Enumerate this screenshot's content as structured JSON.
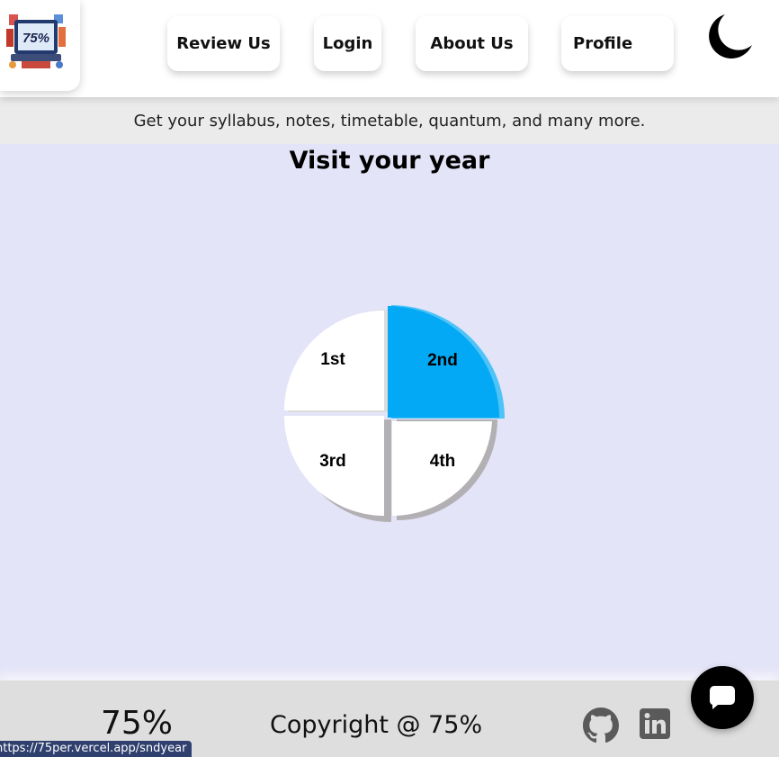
{
  "header": {
    "logo_text": "75%",
    "nav": {
      "review": "Review Us",
      "login": "Login",
      "about": "About Us",
      "profile": "Profile"
    },
    "theme_icon": "moon-icon"
  },
  "tagline": "Get your syllabus, notes, timetable, quantum, and many more.",
  "main": {
    "title": "Visit your year",
    "years": [
      "1st",
      "2nd",
      "3rd",
      "4th"
    ],
    "highlight_color": "#03a9f4",
    "active_year": "2nd"
  },
  "footer": {
    "brand": "75%",
    "copyright": "Copyright @ 75%",
    "icons": [
      "github-icon",
      "linkedin-icon"
    ]
  },
  "chat": {
    "icon": "chat-icon"
  },
  "status_url": "https://75per.vercel.app/sndyear"
}
